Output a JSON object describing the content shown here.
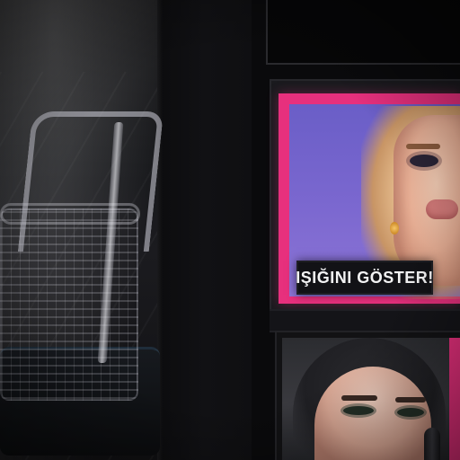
{
  "scene": {
    "poster_main": {
      "caption": "IŞIĞINI GÖSTER!",
      "accent_color": "#e7307d",
      "background_color": "#6a5ec7"
    },
    "poster_secondary": {
      "accent_color": "#e7307d"
    }
  }
}
